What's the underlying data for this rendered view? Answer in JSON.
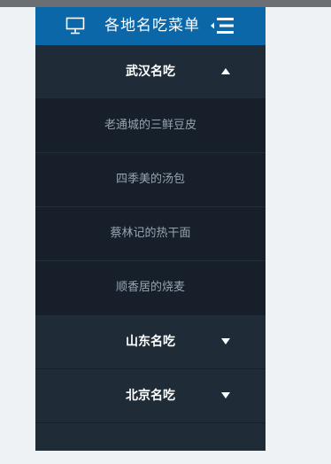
{
  "header": {
    "title": "各地名吃菜单",
    "monitor_icon": "monitor-icon",
    "collapse_icon": "menu-collapse-icon"
  },
  "groups": [
    {
      "label": "武汉名吃",
      "expanded": true,
      "arrow_icon": "caret-up-icon",
      "items": [
        {
          "label": "老通城的三鲜豆皮"
        },
        {
          "label": "四季美的汤包"
        },
        {
          "label": "蔡林记的热干面"
        },
        {
          "label": "顺香居的烧麦"
        }
      ]
    },
    {
      "label": "山东名吃",
      "expanded": false,
      "arrow_icon": "caret-down-icon"
    },
    {
      "label": "北京名吃",
      "expanded": false,
      "arrow_icon": "caret-down-icon"
    }
  ],
  "colors": {
    "header_bg": "#0c67a8",
    "menu_bg": "#1f2c38",
    "submenu_bg": "#17202a",
    "submenu_text": "#96a3b0"
  }
}
